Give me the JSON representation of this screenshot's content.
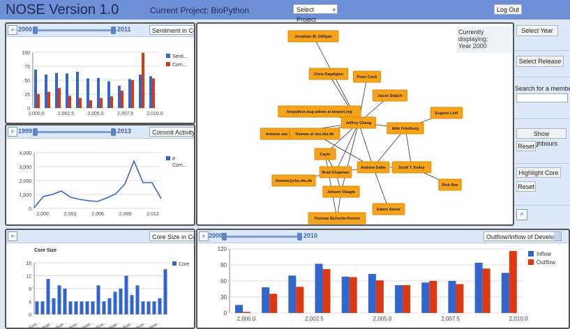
{
  "header": {
    "title": "NOSE Version 1.0",
    "project_label": "Current Project: BioPython",
    "select_project": "Select Project",
    "logout": "Log Out"
  },
  "sentiment_panel": {
    "start_year": "2000",
    "end_year": "2011",
    "dropdown": "Sentiment in Comm",
    "chart_data": {
      "type": "bar",
      "x": [
        2000,
        2001,
        2002,
        2003,
        2004,
        2005,
        2006,
        2007,
        2008,
        2009,
        2010,
        2011
      ],
      "series": [
        {
          "name": "Senti...",
          "color": "#3366cc",
          "values": [
            69,
            60,
            63,
            62,
            65,
            53,
            54,
            48,
            40,
            52,
            60,
            57
          ]
        },
        {
          "name": "Com...",
          "color": "#dc3912",
          "values": [
            25,
            29,
            36,
            22,
            18,
            14,
            18,
            21,
            31,
            50,
            99,
            53
          ]
        }
      ],
      "ylim": [
        0,
        100
      ],
      "yticks": [
        "0",
        "25",
        "50",
        "75",
        "100"
      ],
      "xticks": [
        "2,000.0",
        "2,002.5",
        "2,005.0",
        "2,007.5",
        "2,010.0"
      ]
    }
  },
  "commit_panel": {
    "start_year": "1999",
    "end_year": "2013",
    "dropdown": "Commit Activity",
    "chart_data": {
      "type": "line",
      "x": [
        1999,
        2000,
        2001,
        2002,
        2003,
        2004,
        2005,
        2006,
        2007,
        2008,
        2009,
        2010,
        2011,
        2012
      ],
      "series": [
        {
          "name": "#\nCom...",
          "color": "#3366cc",
          "values": [
            50,
            850,
            1000,
            1250,
            800,
            650,
            550,
            500,
            750,
            1050,
            1750,
            3400,
            1850,
            1850,
            700
          ]
        }
      ],
      "ylim": [
        0,
        4000
      ],
      "yticks": [
        "0",
        "1,000",
        "2,000",
        "3,000",
        "4,000"
      ],
      "xticks": [
        "2,000",
        "2,003",
        "2,006",
        "2,009",
        "2,012"
      ]
    }
  },
  "core_panel": {
    "dropdown": "Core Size in Comm",
    "chart_data": {
      "type": "bar",
      "title": "Core Size",
      "series": [
        {
          "name": "Core",
          "color": "#3366cc",
          "values": [
            4,
            4,
            11,
            5,
            9,
            8,
            4,
            4,
            4,
            4,
            4,
            9,
            4,
            5,
            7,
            8,
            12,
            6,
            9,
            4,
            4,
            4,
            5,
            14
          ]
        }
      ],
      "ylim": [
        0,
        16
      ],
      "yticks": [
        "0",
        "4",
        "8",
        "12",
        "16"
      ],
      "xtick_label": "Biop..."
    }
  },
  "network": {
    "currently_displaying": "Currently displaying:",
    "year": "Year 2000",
    "nodes": [
      {
        "label": "Jonathan M. Gilligan"
      },
      {
        "label": "Chris Dagdigian"
      },
      {
        "label": "Peter Cock"
      },
      {
        "label": "Jason Stajich"
      },
      {
        "label": "Eugene Leitl"
      },
      {
        "label": "biopython-bug-admin at bioperl.org"
      },
      {
        "label": "Jeffrey Chang"
      },
      {
        "label": "Iddo Friedberg"
      },
      {
        "label": "Antoine van Gelder"
      },
      {
        "label": "thomas at cbs.dtu.dk"
      },
      {
        "label": "Cayte"
      },
      {
        "label": "Brad Chapman"
      },
      {
        "label": "Andrew Dalke"
      },
      {
        "label": "Scott T. Kelley"
      },
      {
        "label": "thomas@cbs.dtu.dk"
      },
      {
        "label": "Johann Visagie"
      },
      {
        "label": "Rick Ree"
      },
      {
        "label": "Edwin Steele"
      },
      {
        "label": "Thomas Sicheritz-Ponten"
      }
    ]
  },
  "sidebar": {
    "select_year": "Select Year",
    "select_release": "Select Release",
    "search_label": "Search for a member:",
    "search_value": "",
    "show_neighbours": "Show Neighbours",
    "reset1": "Reset",
    "highlight_core": "Highlight Core",
    "reset2": "Reset"
  },
  "flow_panel": {
    "start_year": "2000",
    "end_year": "2010",
    "dropdown": "Outflow/Inflow of Developers",
    "chart_data": {
      "type": "bar",
      "x": [
        2000,
        2001,
        2002,
        2003,
        2004,
        2005,
        2006,
        2007,
        2008,
        2009,
        2010
      ],
      "series": [
        {
          "name": "Inflow",
          "color": "#3366cc",
          "values": [
            15,
            48,
            70,
            92,
            68,
            73,
            52,
            57,
            60,
            94,
            75
          ]
        },
        {
          "name": "Outflow",
          "color": "#dc3912",
          "values": [
            2,
            36,
            49,
            82,
            67,
            61,
            52,
            60,
            54,
            83,
            116
          ]
        }
      ],
      "ylim": [
        0,
        120
      ],
      "yticks": [
        "0",
        "30",
        "60",
        "90",
        "120"
      ],
      "xticks": [
        "2,000.0",
        "2,002.5",
        "2,005.0",
        "2,007.5",
        "2,010.0"
      ]
    }
  }
}
